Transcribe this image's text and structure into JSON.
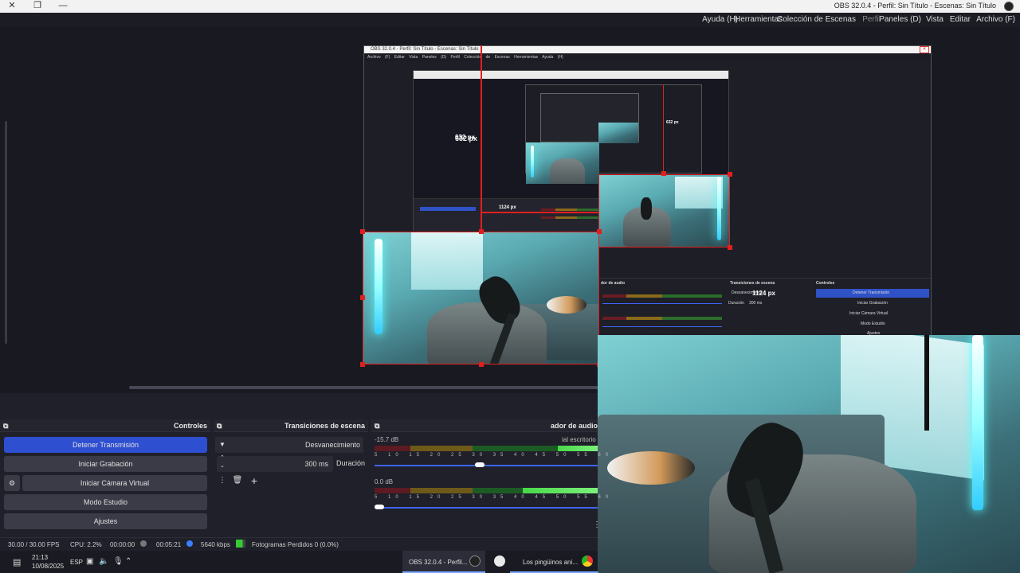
{
  "window": {
    "title": "OBS 32.0.4 - Perfil: Sin Título - Escenas: Sin Título",
    "controls": {
      "close": "✕",
      "restore": "❐",
      "minimize": "—"
    }
  },
  "menu": [
    "Archivo (F)",
    "Editar",
    "Vista",
    "Paneles (D)",
    "Perfil",
    "Colección de Escenas",
    "Herramientas",
    "Ayuda (H)"
  ],
  "nested": {
    "title": "OBS 32.0.4 - Perfil: Sin Título - Escenas: Sin Título",
    "menu_text": "Archivo (F) Editar Vista Paneles (D) Perfil Colección de Escenas Herramientas Ayuda (H)",
    "dim_label_632": "632 px",
    "dim_label_1124": "1124 px",
    "dim_label_632_small": "632 px",
    "dim_label_1124_small": "1124 px",
    "docks": {
      "mixer": "dor de audio",
      "transitions": "Transiciones de escena",
      "controls": "Controles",
      "fade": "Desvanecimiento",
      "duration": "Duración",
      "duration_val": "300 ms",
      "stop": "Detener Transmisión",
      "record": "Iniciar Grabación",
      "vcam": "Iniciar Cámara Virtual",
      "studio": "Modo Estudio",
      "settings": "Ajustes"
    }
  },
  "docks": {
    "audio": {
      "title": "ador de audio",
      "channels": [
        {
          "name": "ial escritorio",
          "db": "-15.7 dB",
          "level": 0.66
        },
        {
          "name": "",
          "db": "0.0 dB",
          "level": 0.5
        }
      ],
      "scale": "5 10 15 20 25 30 35 40 45 50 55 60"
    },
    "transitions": {
      "title": "Transiciones de escena",
      "selected": "Desvanecimiento",
      "duration_label": "Duración",
      "duration_value": "300 ms"
    },
    "controls": {
      "title": "Controles",
      "buttons": [
        "Detener Transmisión",
        "Iniciar Grabación",
        "Iniciar Cámara Virtual",
        "Modo Estudio",
        "Ajustes"
      ]
    }
  },
  "status": {
    "dropped": "Fotogramas Perdidos 0 (0.0%)",
    "bitrate": "5640 kbps",
    "stream_time": "00:05:21",
    "rec_time": "00:00:00",
    "cpu": "CPU: 2.2%",
    "fps": "30.00 / 30.00 FPS"
  },
  "taskbar": {
    "app1": "Los pingüinos ani...",
    "app2": "OBS 32.0.4 - Perfil...",
    "lang": "ESP",
    "time": "21:13",
    "date": "10/08/2025"
  },
  "colors": {
    "accent": "#2f4fd1",
    "selection": "#e02020",
    "bg": "#1f2029"
  }
}
